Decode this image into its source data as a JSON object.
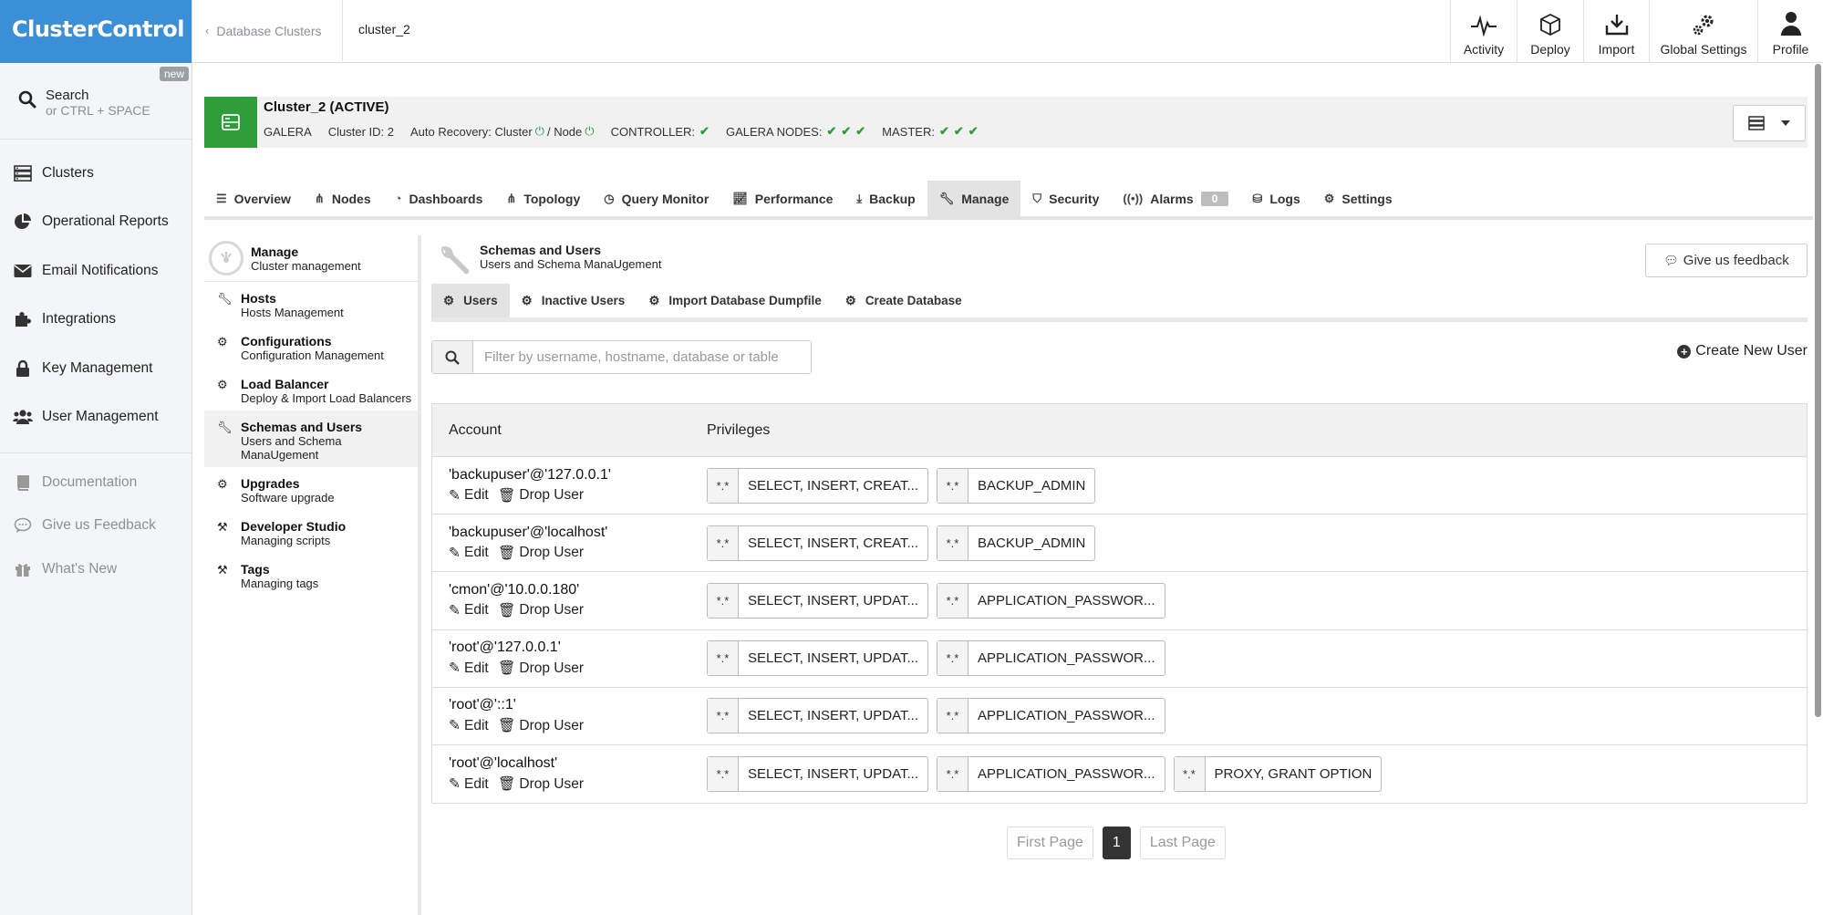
{
  "app": {
    "logo": "ClusterControl"
  },
  "leftnav": {
    "search": {
      "label": "Search",
      "hint": "or CTRL + SPACE",
      "badge": "new"
    },
    "items": [
      {
        "label": "Clusters",
        "icon": "server-stack-icon"
      },
      {
        "label": "Operational Reports",
        "icon": "pie-chart-icon"
      },
      {
        "label": "Email Notifications",
        "icon": "envelope-icon"
      },
      {
        "label": "Integrations",
        "icon": "puzzle-icon"
      },
      {
        "label": "Key Management",
        "icon": "lock-icon"
      },
      {
        "label": "User Management",
        "icon": "users-icon"
      }
    ],
    "secondary": [
      {
        "label": "Documentation",
        "icon": "book-icon"
      },
      {
        "label": "Give us Feedback",
        "icon": "chat-icon"
      },
      {
        "label": "What's New",
        "icon": "gift-icon"
      }
    ]
  },
  "topbar": {
    "breadcrumb": "Database Clusters",
    "current": "cluster_2",
    "actions": [
      {
        "label": "Activity",
        "icon": "pulse-icon"
      },
      {
        "label": "Deploy",
        "icon": "cube-icon"
      },
      {
        "label": "Import",
        "icon": "import-icon"
      },
      {
        "label": "Global Settings",
        "icon": "gears-icon"
      },
      {
        "label": "Profile",
        "icon": "user-icon"
      }
    ]
  },
  "cluster": {
    "name": "Cluster_2 (ACTIVE)",
    "type": "GALERA",
    "id_label": "Cluster ID: 2",
    "auto_recovery_label": "Auto Recovery: Cluster",
    "node_label": "/ Node",
    "controller_label": "CONTROLLER:",
    "galera_nodes_label": "GALERA NODES:",
    "master_label": "MASTER:",
    "status_color": "#2e9d3a"
  },
  "tabs": [
    {
      "label": "Overview",
      "icon": "list-icon"
    },
    {
      "label": "Nodes",
      "icon": "nodes-icon"
    },
    {
      "label": "Dashboards",
      "icon": "dashboard-icon"
    },
    {
      "label": "Topology",
      "icon": "topology-icon"
    },
    {
      "label": "Query Monitor",
      "icon": "clock-icon"
    },
    {
      "label": "Performance",
      "icon": "line-chart-icon"
    },
    {
      "label": "Backup",
      "icon": "download-icon"
    },
    {
      "label": "Manage",
      "icon": "wrench-icon",
      "active": true
    },
    {
      "label": "Security",
      "icon": "shield-icon"
    },
    {
      "label": "Alarms",
      "icon": "signal-icon",
      "count": "0"
    },
    {
      "label": "Logs",
      "icon": "inbox-icon"
    },
    {
      "label": "Settings",
      "icon": "gear-icon"
    }
  ],
  "subside": {
    "head": {
      "title": "Manage",
      "desc": "Cluster management"
    },
    "items": [
      {
        "title": "Hosts",
        "desc": "Hosts Management",
        "icon": "wrench-icon"
      },
      {
        "title": "Configurations",
        "desc": "Configuration Management",
        "icon": "gear-icon"
      },
      {
        "title": "Load Balancer",
        "desc": "Deploy & Import Load Balancers",
        "icon": "gear-icon"
      },
      {
        "title": "Schemas and Users",
        "desc": "Users and Schema ManaUgement",
        "icon": "wrench-icon",
        "active": true
      },
      {
        "title": "Upgrades",
        "desc": "Software upgrade",
        "icon": "gear-icon"
      },
      {
        "title": "Developer Studio",
        "desc": "Managing scripts",
        "icon": "hammer-icon"
      },
      {
        "title": "Tags",
        "desc": "Managing tags",
        "icon": "hammer-icon"
      }
    ]
  },
  "main": {
    "title": "Schemas and Users",
    "subtitle": "Users and Schema ManaUgement",
    "feedback": "Give us feedback",
    "subtabs": [
      {
        "label": "Users",
        "active": true
      },
      {
        "label": "Inactive Users"
      },
      {
        "label": "Import Database Dumpfile"
      },
      {
        "label": "Create Database"
      }
    ],
    "filter_placeholder": "Filter by username, hostname, database or table",
    "create_user": "Create New User",
    "table": {
      "headers": {
        "account": "Account",
        "privileges": "Privileges"
      },
      "edit_label": "Edit",
      "drop_label": "Drop User",
      "rows": [
        {
          "account": "'backupuser'@'127.0.0.1'",
          "privs": [
            {
              "scope": "*.*",
              "list": "SELECT, INSERT, CREAT..."
            },
            {
              "scope": "*.*",
              "list": "BACKUP_ADMIN"
            }
          ]
        },
        {
          "account": "'backupuser'@'localhost'",
          "privs": [
            {
              "scope": "*.*",
              "list": "SELECT, INSERT, CREAT..."
            },
            {
              "scope": "*.*",
              "list": "BACKUP_ADMIN"
            }
          ]
        },
        {
          "account": "'cmon'@'10.0.0.180'",
          "privs": [
            {
              "scope": "*.*",
              "list": "SELECT, INSERT, UPDAT..."
            },
            {
              "scope": "*.*",
              "list": "APPLICATION_PASSWOR..."
            }
          ]
        },
        {
          "account": "'root'@'127.0.0.1'",
          "privs": [
            {
              "scope": "*.*",
              "list": "SELECT, INSERT, UPDAT..."
            },
            {
              "scope": "*.*",
              "list": "APPLICATION_PASSWOR..."
            }
          ]
        },
        {
          "account": "'root'@'::1'",
          "privs": [
            {
              "scope": "*.*",
              "list": "SELECT, INSERT, UPDAT..."
            },
            {
              "scope": "*.*",
              "list": "APPLICATION_PASSWOR..."
            }
          ]
        },
        {
          "account": "'root'@'localhost'",
          "privs": [
            {
              "scope": "*.*",
              "list": "SELECT, INSERT, UPDAT..."
            },
            {
              "scope": "*.*",
              "list": "APPLICATION_PASSWOR..."
            },
            {
              "scope": "*.*",
              "list": "PROXY, GRANT OPTION"
            }
          ]
        }
      ]
    },
    "pager": {
      "first": "First Page",
      "current": "1",
      "last": "Last Page"
    }
  }
}
